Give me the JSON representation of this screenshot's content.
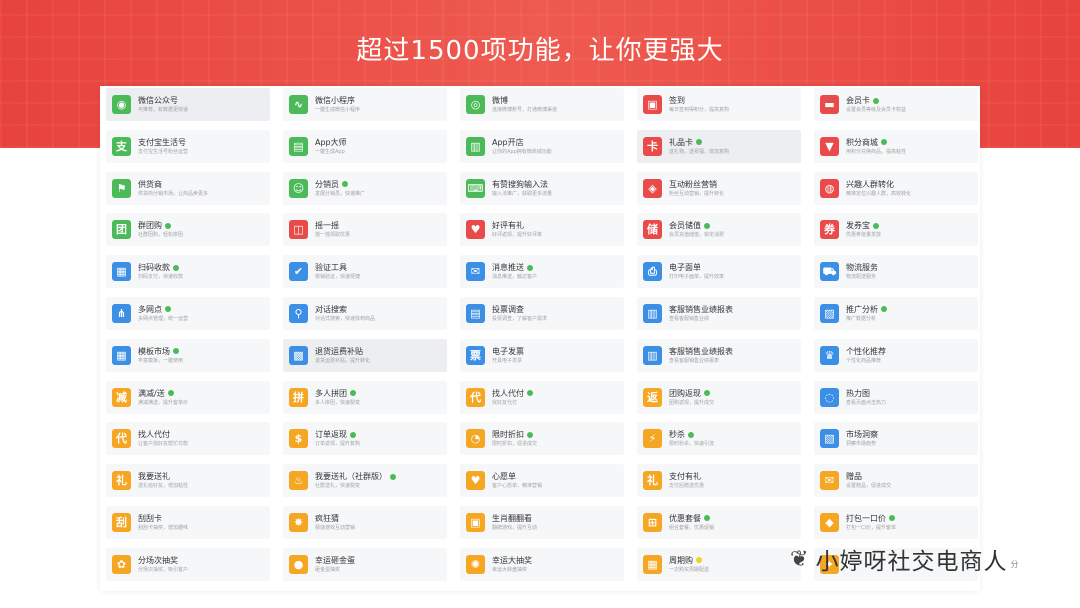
{
  "banner": {
    "title": "超过1500项功能，让你更强大"
  },
  "watermark": {
    "text": "小婷呀社交电商人",
    "suffix": "分"
  },
  "rows": [
    [
      {
        "name": "微信公众号",
        "desc": "可推荐，有数据更快速",
        "color": "#4cba58",
        "glyph": "◉",
        "icon": "wechat-icon",
        "badge": false,
        "hl": true
      },
      {
        "name": "微信小程序",
        "desc": "一键生成微信小程序",
        "color": "#4cba58",
        "glyph": "∿",
        "icon": "mini-program-icon",
        "badge": false
      },
      {
        "name": "微博",
        "desc": "连接微博账号，打通微博渠道",
        "color": "#4cba58",
        "glyph": "◎",
        "icon": "weibo-icon",
        "badge": false
      },
      {
        "name": "签到",
        "desc": "每日签到得积分，提高复购",
        "color": "#e94b4b",
        "glyph": "▣",
        "icon": "sign-in-icon",
        "badge": false
      },
      {
        "name": "会员卡",
        "desc": "设置会员等级及会员卡权益",
        "color": "#e94b4b",
        "glyph": "▬",
        "icon": "member-card-icon",
        "badge": true
      }
    ],
    [
      {
        "name": "支付宝生活号",
        "desc": "支付宝生活号粉丝运营",
        "color": "#4cba58",
        "glyph": "支",
        "icon": "alipay-icon",
        "badge": false
      },
      {
        "name": "App大师",
        "desc": "一键生成App",
        "color": "#4cba58",
        "glyph": "▤",
        "icon": "app-master-icon",
        "badge": false
      },
      {
        "name": "App开店",
        "desc": "让你的App拥有微商城功能",
        "color": "#4cba58",
        "glyph": "▥",
        "icon": "app-store-icon",
        "badge": false
      },
      {
        "name": "礼品卡",
        "desc": "送礼物，送祝福，增加复购",
        "color": "#e94b4b",
        "glyph": "卡",
        "icon": "gift-card-icon",
        "badge": true,
        "hl": true
      },
      {
        "name": "积分商城",
        "desc": "用积分兑换商品，提高粘性",
        "color": "#e94b4b",
        "glyph": "▼",
        "icon": "points-mall-icon",
        "badge": true
      }
    ],
    [
      {
        "name": "供货商",
        "desc": "供货商分销市场，让商品卖更多",
        "color": "#4cba58",
        "glyph": "⚑",
        "icon": "supplier-icon",
        "badge": false
      },
      {
        "name": "分销员",
        "desc": "发展分销员，快速推广",
        "color": "#4cba58",
        "glyph": "☺",
        "icon": "distributor-icon",
        "badge": true
      },
      {
        "name": "有赞搜狗输入法",
        "desc": "输入法推广，获取更多流量",
        "color": "#4cba58",
        "glyph": "⌨",
        "icon": "input-method-icon",
        "badge": false
      },
      {
        "name": "互动粉丝营销",
        "desc": "粉丝互动营销，提升转化",
        "color": "#e94b4b",
        "glyph": "◈",
        "icon": "fans-marketing-icon",
        "badge": false
      },
      {
        "name": "兴趣人群转化",
        "desc": "精准定位兴趣人群，高效转化",
        "color": "#e94b4b",
        "glyph": "◍",
        "icon": "audience-icon",
        "badge": false
      }
    ],
    [
      {
        "name": "群团购",
        "desc": "社群团购，轻松拼团",
        "color": "#4cba58",
        "glyph": "团",
        "icon": "group-buy-icon",
        "badge": true
      },
      {
        "name": "摇一摇",
        "desc": "摇一摇领取优惠",
        "color": "#e94b4b",
        "glyph": "◫",
        "icon": "shake-icon",
        "badge": false
      },
      {
        "name": "好评有礼",
        "desc": "好评返现，提升好评率",
        "color": "#e94b4b",
        "glyph": "♥",
        "icon": "review-gift-icon",
        "badge": false
      },
      {
        "name": "会员储值",
        "desc": "会员充值储值，锁定消费",
        "color": "#e94b4b",
        "glyph": "储",
        "icon": "stored-value-icon",
        "badge": true
      },
      {
        "name": "发券宝",
        "desc": "优惠券批量发放",
        "color": "#e94b4b",
        "glyph": "券",
        "icon": "coupon-icon",
        "badge": true
      }
    ],
    [
      {
        "name": "扫码收款",
        "desc": "扫码支付，快速收款",
        "color": "#3b8fe5",
        "glyph": "▦",
        "icon": "scan-pay-icon",
        "badge": true
      },
      {
        "name": "验证工具",
        "desc": "核销验证，快速便捷",
        "color": "#3b8fe5",
        "glyph": "✔",
        "icon": "verify-tool-icon",
        "badge": false
      },
      {
        "name": "消息推送",
        "desc": "消息推送，触达客户",
        "color": "#3b8fe5",
        "glyph": "✉",
        "icon": "message-push-icon",
        "badge": true
      },
      {
        "name": "电子面单",
        "desc": "打印电子面单，提升效率",
        "color": "#3b8fe5",
        "glyph": "⎙",
        "icon": "e-waybill-icon",
        "badge": false
      },
      {
        "name": "物流服务",
        "desc": "物流配送服务",
        "color": "#3b8fe5",
        "glyph": "⛟",
        "icon": "logistics-icon",
        "badge": false
      }
    ],
    [
      {
        "name": "多网点",
        "desc": "多网点管理，统一运营",
        "color": "#3b8fe5",
        "glyph": "⋔",
        "icon": "multi-store-icon",
        "badge": true
      },
      {
        "name": "对话搜索",
        "desc": "对话式搜索，快速找到商品",
        "color": "#3b8fe5",
        "glyph": "⚲",
        "icon": "dialog-search-icon",
        "badge": false
      },
      {
        "name": "投票调查",
        "desc": "投票调查，了解客户需求",
        "color": "#3b8fe5",
        "glyph": "▤",
        "icon": "vote-survey-icon",
        "badge": false
      },
      {
        "name": "客服销售业绩报表",
        "desc": "查看客服销售业绩",
        "color": "#3b8fe5",
        "glyph": "▥",
        "icon": "service-report-icon",
        "badge": false
      },
      {
        "name": "推广分析",
        "desc": "推广数据分析",
        "color": "#3b8fe5",
        "glyph": "▨",
        "icon": "promotion-analysis-icon",
        "badge": true
      }
    ],
    [
      {
        "name": "模板市场",
        "desc": "丰富模板，一键使用",
        "color": "#3b8fe5",
        "glyph": "▦",
        "icon": "template-market-icon",
        "badge": true
      },
      {
        "name": "退货运费补贴",
        "desc": "退货运费补贴，提升转化",
        "color": "#3b8fe5",
        "glyph": "▩",
        "icon": "return-shipping-icon",
        "badge": false,
        "hl": true
      },
      {
        "name": "电子发票",
        "desc": "开具电子发票",
        "color": "#3b8fe5",
        "glyph": "票",
        "icon": "e-invoice-icon",
        "badge": false
      },
      {
        "name": "客服销售业绩报表",
        "desc": "查看客服销售业绩报表",
        "color": "#3b8fe5",
        "glyph": "▥",
        "icon": "sales-report-icon",
        "badge": false
      },
      {
        "name": "个性化推荐",
        "desc": "个性化商品推荐",
        "color": "#3b8fe5",
        "glyph": "♛",
        "icon": "recommend-icon",
        "badge": false
      }
    ],
    [
      {
        "name": "满减/送",
        "desc": "满减满送，提升客单价",
        "color": "#f5a623",
        "glyph": "减",
        "icon": "full-reduction-icon",
        "badge": true
      },
      {
        "name": "多人拼团",
        "desc": "多人拼团，快速裂变",
        "color": "#f5a623",
        "glyph": "拼",
        "icon": "group-icon",
        "badge": true
      },
      {
        "name": "找人代付",
        "desc": "找好友代付",
        "color": "#f5a623",
        "glyph": "代",
        "icon": "pay-for-me-icon",
        "badge": true
      },
      {
        "name": "团购返现",
        "desc": "团购返现，提升成交",
        "color": "#f5a623",
        "glyph": "返",
        "icon": "cashback-icon",
        "badge": true
      },
      {
        "name": "热力图",
        "desc": "查看页面点击热力",
        "color": "#3b8fe5",
        "glyph": "◌",
        "icon": "heatmap-icon",
        "badge": false
      }
    ],
    [
      {
        "name": "找人代付",
        "desc": "让客户找好友帮忙付款",
        "color": "#f5a623",
        "glyph": "代",
        "icon": "friend-pay-icon",
        "badge": false
      },
      {
        "name": "订单返现",
        "desc": "订单返现，提升复购",
        "color": "#f5a623",
        "glyph": "$",
        "icon": "order-cashback-icon",
        "badge": true
      },
      {
        "name": "限时折扣",
        "desc": "限时折扣，促进成交",
        "color": "#f5a623",
        "glyph": "◔",
        "icon": "flash-discount-icon",
        "badge": true
      },
      {
        "name": "秒杀",
        "desc": "限时秒杀，快速引流",
        "color": "#f5a623",
        "glyph": "⚡",
        "icon": "flash-sale-icon",
        "badge": true
      },
      {
        "name": "市场洞察",
        "desc": "洞察市场趋势",
        "color": "#3b8fe5",
        "glyph": "▧",
        "icon": "market-insight-icon",
        "badge": false
      }
    ],
    [
      {
        "name": "我要送礼",
        "desc": "送礼给好友，增加粘性",
        "color": "#f5a623",
        "glyph": "礼",
        "icon": "send-gift-icon",
        "badge": false
      },
      {
        "name": "我要送礼（社群版）",
        "desc": "社群送礼，快速裂变",
        "color": "#f5a623",
        "glyph": "♨",
        "icon": "community-gift-icon",
        "badge": true
      },
      {
        "name": "心愿单",
        "desc": "客户心愿单，精准营销",
        "color": "#f5a623",
        "glyph": "♥",
        "icon": "wish-list-icon",
        "badge": false
      },
      {
        "name": "支付有礼",
        "desc": "支付后赠送优惠",
        "color": "#f5a623",
        "glyph": "礼",
        "icon": "pay-gift-icon",
        "badge": false
      },
      {
        "name": "赠品",
        "desc": "设置赠品，促进成交",
        "color": "#f5a623",
        "glyph": "✉",
        "icon": "freebie-icon",
        "badge": false
      }
    ],
    [
      {
        "name": "刮刮卡",
        "desc": "刮刮卡抽奖，增加趣味",
        "color": "#f5a623",
        "glyph": "刮",
        "icon": "scratch-card-icon",
        "badge": false
      },
      {
        "name": "疯狂猜",
        "desc": "猜谜游戏互动营销",
        "color": "#f5a623",
        "glyph": "✸",
        "icon": "guess-icon",
        "badge": false
      },
      {
        "name": "生肖翻翻看",
        "desc": "翻牌游戏，提升互动",
        "color": "#f5a623",
        "glyph": "▣",
        "icon": "zodiac-flip-icon",
        "badge": false
      },
      {
        "name": "优惠套餐",
        "desc": "组合套餐，优惠促销",
        "color": "#f5a623",
        "glyph": "⊞",
        "icon": "bundle-icon",
        "badge": true
      },
      {
        "name": "打包一口价",
        "desc": "打包一口价，提升客单",
        "color": "#f5a623",
        "glyph": "◆",
        "icon": "package-price-icon",
        "badge": true
      }
    ],
    [
      {
        "name": "分场次抽奖",
        "desc": "分场次抽奖，吸引客户",
        "color": "#f5a623",
        "glyph": "✿",
        "icon": "session-lottery-icon",
        "badge": false
      },
      {
        "name": "幸运砸金蛋",
        "desc": "砸金蛋抽奖",
        "color": "#f5a623",
        "glyph": "●",
        "icon": "golden-egg-icon",
        "badge": false
      },
      {
        "name": "幸运大抽奖",
        "desc": "幸运大转盘抽奖",
        "color": "#f5a623",
        "glyph": "✺",
        "icon": "lucky-draw-icon",
        "badge": false
      },
      {
        "name": "周期购",
        "desc": "一次购买周期配送",
        "color": "#f5a623",
        "glyph": "▦",
        "icon": "subscription-icon",
        "badge": true,
        "badgeColor": "#f5d023"
      },
      {
        "name": "",
        "desc": "",
        "color": "#f5a623",
        "glyph": "✦",
        "icon": "more-icon",
        "badge": false
      }
    ]
  ]
}
